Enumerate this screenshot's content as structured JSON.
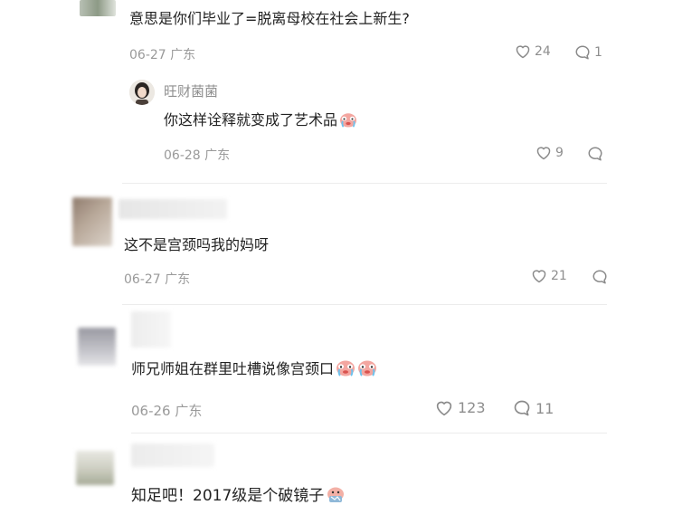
{
  "comments": [
    {
      "text": "意思是你们毕业了=脱离母校在社会上新生?",
      "date": "06-27",
      "location": "广东",
      "likes": "24",
      "replies": "1",
      "reply": {
        "username": "旺财菌菌",
        "text": "你这样诠释就变成了艺术品",
        "date": "06-28",
        "location": "广东",
        "likes": "9"
      }
    },
    {
      "text": "这不是宫颈吗我的妈呀",
      "date": "06-27",
      "location": "广东",
      "likes": "21"
    },
    {
      "text": "师兄师姐在群里吐槽说像宫颈口",
      "date": "06-26",
      "location": "广东",
      "likes": "123",
      "replies": "11"
    },
    {
      "text": "知足吧！2017级是个破镜子"
    }
  ],
  "icons": {
    "like": "heart-icon",
    "reply": "comment-bubble-icon",
    "emoji_sob": "crying-face-emoji",
    "emoji_broken": "broken-mirror-emoji"
  },
  "colors": {
    "meta": "#9a9a9a",
    "text": "#222222",
    "separator": "#ececec"
  }
}
